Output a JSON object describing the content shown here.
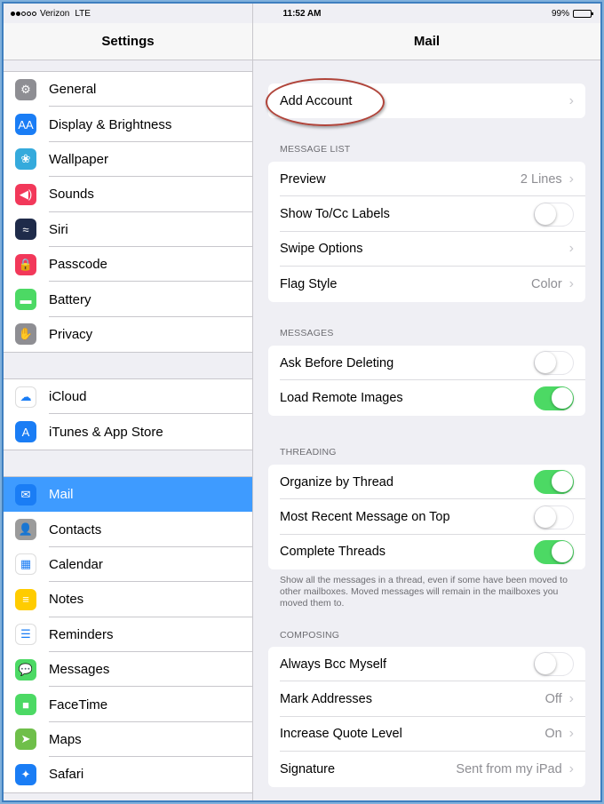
{
  "status": {
    "carrier": "Verizon",
    "network": "LTE",
    "time": "11:52 AM",
    "battery": "99%"
  },
  "left": {
    "title": "Settings",
    "group1": [
      {
        "label": "General",
        "icon": "gear-icon",
        "color": "#8e8e93",
        "glyph": "⚙"
      },
      {
        "label": "Display & Brightness",
        "icon": "display-brightness-icon",
        "color": "#1a7df5",
        "glyph": "AA"
      },
      {
        "label": "Wallpaper",
        "icon": "wallpaper-icon",
        "color": "#35aadc",
        "glyph": "❀"
      },
      {
        "label": "Sounds",
        "icon": "speaker-icon",
        "color": "#f2385a",
        "glyph": "◀)"
      },
      {
        "label": "Siri",
        "icon": "siri-icon",
        "color": "#1f2b4a",
        "glyph": "≈"
      },
      {
        "label": "Passcode",
        "icon": "lock-icon",
        "color": "#f2385a",
        "glyph": "🔒"
      },
      {
        "label": "Battery",
        "icon": "battery-icon",
        "color": "#4cd964",
        "glyph": "▬"
      },
      {
        "label": "Privacy",
        "icon": "hand-icon",
        "color": "#8e8e93",
        "glyph": "✋"
      }
    ],
    "group2": [
      {
        "label": "iCloud",
        "icon": "cloud-icon",
        "color": "#ffffff",
        "glyph": "☁"
      },
      {
        "label": "iTunes & App Store",
        "icon": "app-store-icon",
        "color": "#1a7df5",
        "glyph": "A"
      }
    ],
    "group3": [
      {
        "label": "Mail",
        "icon": "mail-icon",
        "color": "#1a7df5",
        "glyph": "✉"
      },
      {
        "label": "Contacts",
        "icon": "contacts-icon",
        "color": "#9b9b9b",
        "glyph": "👤"
      },
      {
        "label": "Calendar",
        "icon": "calendar-icon",
        "color": "#ffffff",
        "glyph": "▦"
      },
      {
        "label": "Notes",
        "icon": "notes-icon",
        "color": "#ffcc00",
        "glyph": "≡"
      },
      {
        "label": "Reminders",
        "icon": "reminders-icon",
        "color": "#ffffff",
        "glyph": "☰"
      },
      {
        "label": "Messages",
        "icon": "messages-icon",
        "color": "#4cd964",
        "glyph": "💬"
      },
      {
        "label": "FaceTime",
        "icon": "facetime-icon",
        "color": "#4cd964",
        "glyph": "■"
      },
      {
        "label": "Maps",
        "icon": "maps-icon",
        "color": "#6fbf4a",
        "glyph": "➤"
      },
      {
        "label": "Safari",
        "icon": "safari-icon",
        "color": "#1a7df5",
        "glyph": "✦"
      }
    ]
  },
  "right": {
    "title": "Mail",
    "add_account": "Add Account",
    "message_list": {
      "header": "MESSAGE LIST",
      "preview": {
        "label": "Preview",
        "value": "2 Lines"
      },
      "show_tocc": {
        "label": "Show To/Cc Labels",
        "on": false
      },
      "swipe": {
        "label": "Swipe Options"
      },
      "flag": {
        "label": "Flag Style",
        "value": "Color"
      }
    },
    "messages": {
      "header": "MESSAGES",
      "ask_delete": {
        "label": "Ask Before Deleting",
        "on": false
      },
      "remote_images": {
        "label": "Load Remote Images",
        "on": true
      }
    },
    "threading": {
      "header": "THREADING",
      "organize": {
        "label": "Organize by Thread",
        "on": true
      },
      "recent_top": {
        "label": "Most Recent Message on Top",
        "on": false
      },
      "complete": {
        "label": "Complete Threads",
        "on": true
      },
      "footnote": "Show all the messages in a thread, even if some have been moved to other mailboxes. Moved messages will remain in the mailboxes you moved them to."
    },
    "composing": {
      "header": "COMPOSING",
      "bcc": {
        "label": "Always Bcc Myself",
        "on": false
      },
      "mark": {
        "label": "Mark Addresses",
        "value": "Off"
      },
      "quote": {
        "label": "Increase Quote Level",
        "value": "On"
      },
      "signature": {
        "label": "Signature",
        "value": "Sent from my iPad"
      }
    }
  }
}
